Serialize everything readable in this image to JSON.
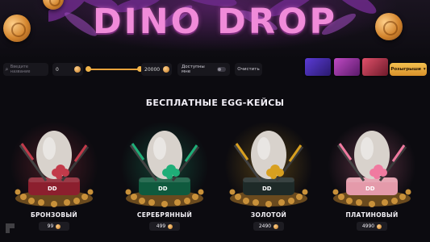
{
  "hero": {
    "logo_text": "DINO DROP"
  },
  "filters": {
    "search_placeholder": "Введите название",
    "min_price": "0",
    "max_price": "20000",
    "available_label": "Доступны мне",
    "clear_label": "Очистить",
    "draw_label": "Розыгрыши"
  },
  "section": {
    "title": "БЕСПЛАТНЫЕ EGG-КЕЙСЫ"
  },
  "cases": [
    {
      "name": "БРОНЗОВЫЙ",
      "price": "99",
      "accent": "#c23a4a",
      "cushion": "#8c1f2e"
    },
    {
      "name": "СЕРЕБРЯННЫЙ",
      "price": "499",
      "accent": "#1fae78",
      "cushion": "#0f5a3e"
    },
    {
      "name": "ЗОЛОТОЙ",
      "price": "2490",
      "accent": "#d8a020",
      "cushion": "#1e2a28"
    },
    {
      "name": "ПЛАТИНОВЫЙ",
      "price": "4990",
      "accent": "#f07aa0",
      "cushion": "#e49aaa"
    }
  ],
  "colors": {
    "background": "#0c0b10",
    "accent_gold": "#f1b44a",
    "logo_pink": "#f08bd9"
  }
}
